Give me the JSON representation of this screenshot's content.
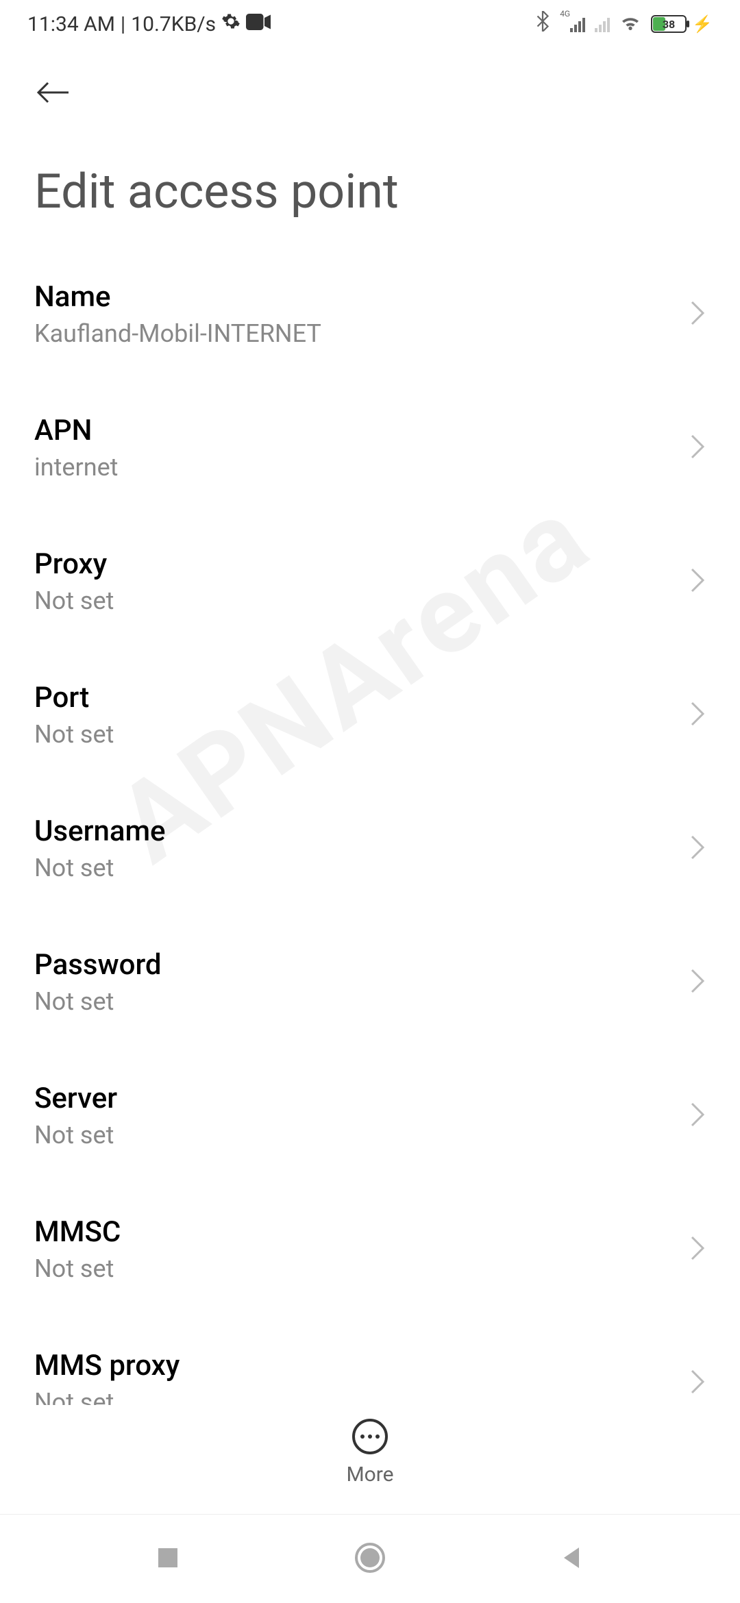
{
  "status_bar": {
    "time": "11:34 AM",
    "data_rate": "10.7KB/s",
    "network_label": "4G",
    "battery_percent": "38"
  },
  "header": {
    "title": "Edit access point"
  },
  "settings": [
    {
      "label": "Name",
      "value": "Kaufland-Mobil-INTERNET"
    },
    {
      "label": "APN",
      "value": "internet"
    },
    {
      "label": "Proxy",
      "value": "Not set"
    },
    {
      "label": "Port",
      "value": "Not set"
    },
    {
      "label": "Username",
      "value": "Not set"
    },
    {
      "label": "Password",
      "value": "Not set"
    },
    {
      "label": "Server",
      "value": "Not set"
    },
    {
      "label": "MMSC",
      "value": "Not set"
    },
    {
      "label": "MMS proxy",
      "value": "Not set"
    }
  ],
  "bottom": {
    "more_label": "More"
  },
  "watermark": "APNArena"
}
